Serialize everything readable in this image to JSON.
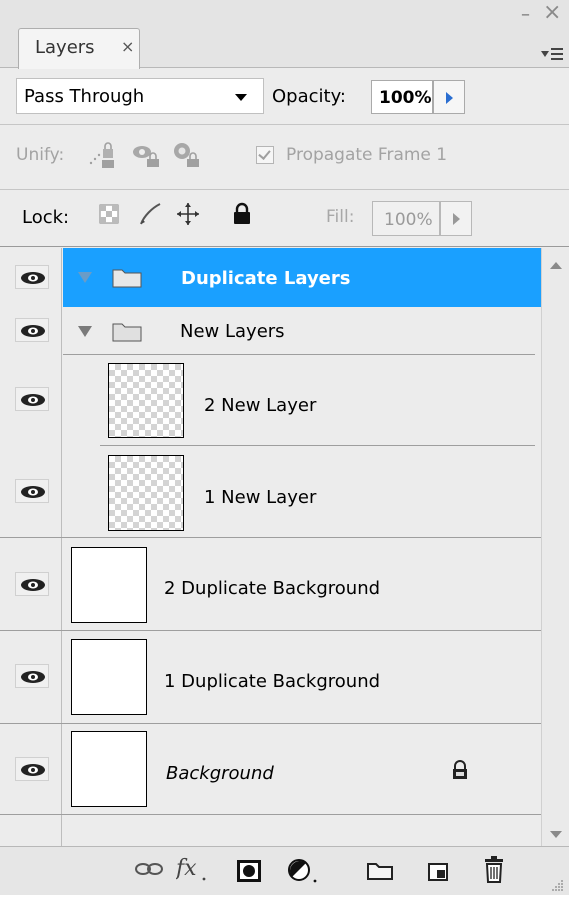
{
  "panel": {
    "tab_label": "Layers",
    "tab_close": "×",
    "win_min": "–",
    "win_close": "×"
  },
  "blend": {
    "mode": "Pass Through",
    "opacity_label": "Opacity:",
    "opacity_value": "100%"
  },
  "unify": {
    "label": "Unify:",
    "propagate_label": "Propagate Frame 1",
    "propagate_checked": true
  },
  "lock": {
    "label": "Lock:",
    "fill_label": "Fill:",
    "fill_value": "100%"
  },
  "layers": [
    {
      "name": "Duplicate Layers",
      "type": "group",
      "expanded": true,
      "selected": true,
      "visible": true
    },
    {
      "name": "New Layers",
      "type": "group",
      "expanded": true,
      "selected": false,
      "visible": true
    },
    {
      "name": "2 New Layer",
      "type": "layer",
      "transparent": true,
      "visible": true
    },
    {
      "name": "1 New Layer",
      "type": "layer",
      "transparent": true,
      "visible": true
    },
    {
      "name": "2 Duplicate Background",
      "type": "layer",
      "visible": true
    },
    {
      "name": "1 Duplicate Background",
      "type": "layer",
      "visible": true
    },
    {
      "name": "Background",
      "type": "background",
      "locked": true,
      "visible": true
    }
  ],
  "colors": {
    "selection": "#1aa0ff",
    "opacity_arrow": "#2a6ed1"
  },
  "bottom_icons": [
    "link-icon",
    "fx-icon",
    "mask-icon",
    "adjustment-icon",
    "folder-icon",
    "new-layer-icon",
    "trash-icon"
  ]
}
